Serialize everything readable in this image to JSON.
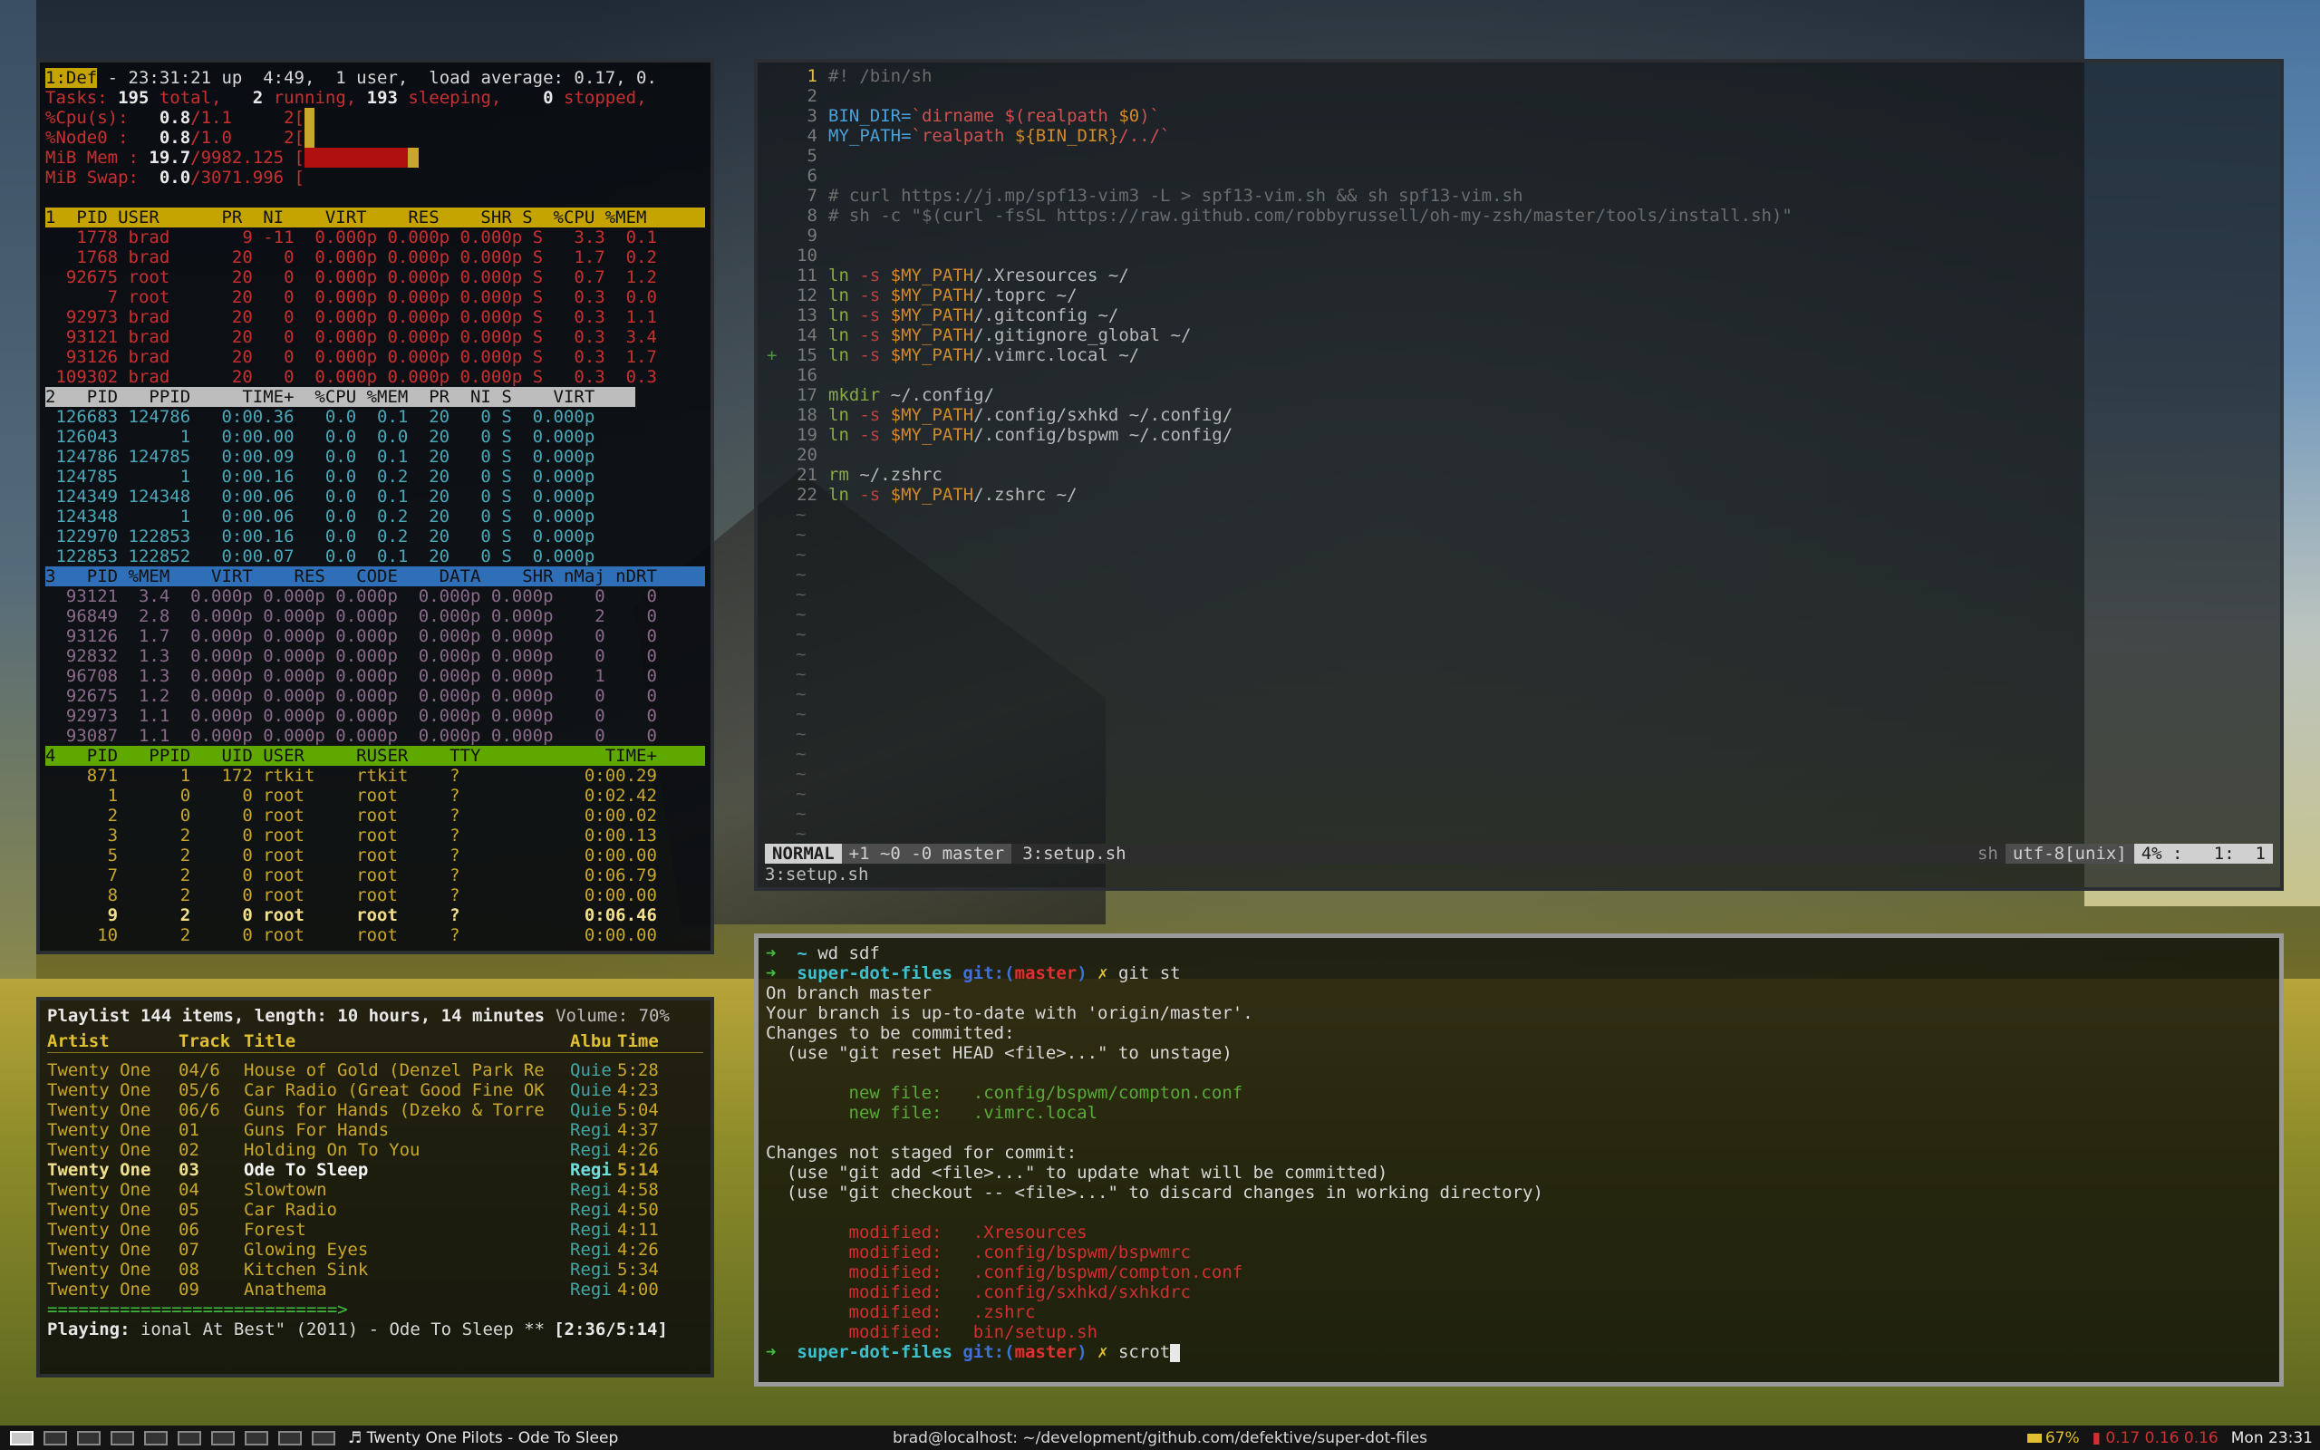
{
  "top": {
    "summary": [
      {
        "parts": [
          [
            "1:Def",
            "hdr1"
          ],
          [
            " - 23:31:21 up  4:49,  1 user,  load average: 0.17, 0.",
            "plain"
          ]
        ]
      },
      {
        "parts": [
          [
            "Tasks: ",
            "red"
          ],
          [
            "195",
            "w"
          ],
          [
            " total, ",
            "red"
          ],
          [
            "  2",
            "w"
          ],
          [
            " running, ",
            "red"
          ],
          [
            "193",
            "w"
          ],
          [
            " sleeping, ",
            "red"
          ],
          [
            "   0",
            "w"
          ],
          [
            " stopped,",
            "red"
          ]
        ]
      },
      {
        "parts": [
          [
            "%Cpu(s): ",
            "red"
          ],
          [
            "  0.8",
            "w"
          ],
          [
            "/1.1     2[",
            "red"
          ],
          [
            "|",
            "yel"
          ]
        ]
      },
      {
        "parts": [
          [
            "%Node0 : ",
            "red"
          ],
          [
            "  0.8",
            "w"
          ],
          [
            "/1.0     2[",
            "red"
          ],
          [
            "|",
            "yel"
          ]
        ]
      },
      {
        "parts": [
          [
            "MiB Mem : ",
            "red"
          ],
          [
            "19.7",
            "w"
          ],
          [
            "/9982.125 [",
            "red"
          ],
          [
            "||||||||||",
            "memred"
          ],
          [
            "|",
            "yel"
          ]
        ]
      },
      {
        "parts": [
          [
            "MiB Swap: ",
            "red"
          ],
          [
            " 0.0",
            "w"
          ],
          [
            "/3071.996 [",
            "red"
          ]
        ]
      }
    ],
    "h1": "1  PID USER      PR  NI    VIRT    RES    SHR S  %CPU %MEM ",
    "rows1": [
      "   1778 brad       9 -11  0.000p 0.000p 0.000p S   3.3  0.1",
      "   1768 brad      20   0  0.000p 0.000p 0.000p S   1.7  0.2",
      "  92675 root      20   0  0.000p 0.000p 0.000p S   0.7  1.2",
      "      7 root      20   0  0.000p 0.000p 0.000p S   0.3  0.0",
      "  92973 brad      20   0  0.000p 0.000p 0.000p S   0.3  1.1",
      "  93121 brad      20   0  0.000p 0.000p 0.000p S   0.3  3.4",
      "  93126 brad      20   0  0.000p 0.000p 0.000p S   0.3  1.7",
      " 109302 brad      20   0  0.000p 0.000p 0.000p S   0.3  0.3"
    ],
    "h2": "2   PID   PPID     TIME+  %CPU %MEM  PR  NI S    VIRT",
    "rows2": [
      " 126683 124786   0:00.36   0.0  0.1  20   0 S  0.000p",
      " 126043      1   0:00.00   0.0  0.0  20   0 S  0.000p",
      " 124786 124785   0:00.09   0.0  0.1  20   0 S  0.000p",
      " 124785      1   0:00.16   0.0  0.2  20   0 S  0.000p",
      " 124349 124348   0:00.06   0.0  0.1  20   0 S  0.000p",
      " 124348      1   0:00.06   0.0  0.2  20   0 S  0.000p",
      " 122970 122853   0:00.16   0.0  0.2  20   0 S  0.000p",
      " 122853 122852   0:00.07   0.0  0.1  20   0 S  0.000p"
    ],
    "h3": "3   PID %MEM    VIRT    RES   CODE    DATA    SHR nMaj nDRT",
    "rows3": [
      "  93121  3.4  0.000p 0.000p 0.000p  0.000p 0.000p    0    0",
      "  96849  2.8  0.000p 0.000p 0.000p  0.000p 0.000p    2    0",
      "  93126  1.7  0.000p 0.000p 0.000p  0.000p 0.000p    0    0",
      "  92832  1.3  0.000p 0.000p 0.000p  0.000p 0.000p    0    0",
      "  96708  1.3  0.000p 0.000p 0.000p  0.000p 0.000p    1    0",
      "  92675  1.2  0.000p 0.000p 0.000p  0.000p 0.000p    0    0",
      "  92973  1.1  0.000p 0.000p 0.000p  0.000p 0.000p    0    0",
      "  93087  1.1  0.000p 0.000p 0.000p  0.000p 0.000p    0    0"
    ],
    "h4": "4   PID   PPID   UID USER     RUSER    TTY            TIME+",
    "rows4": [
      {
        "text": "    871      1   172 rtkit    rtkit    ?            0:00.29",
        "bold": false
      },
      {
        "text": "      1      0     0 root     root     ?            0:02.42",
        "bold": false
      },
      {
        "text": "      2      0     0 root     root     ?            0:00.02",
        "bold": false
      },
      {
        "text": "      3      2     0 root     root     ?            0:00.13",
        "bold": false
      },
      {
        "text": "      5      2     0 root     root     ?            0:00.00",
        "bold": false
      },
      {
        "text": "      7      2     0 root     root     ?            0:06.79",
        "bold": false
      },
      {
        "text": "      8      2     0 root     root     ?            0:00.00",
        "bold": false
      },
      {
        "text": "      9      2     0 root     root     ?            0:06.46",
        "bold": true
      },
      {
        "text": "     10      2     0 root     root     ?            0:00.00",
        "bold": false
      }
    ]
  },
  "playlist": {
    "header": "Playlist 144 items, length: 10 hours, 14 minutes",
    "volume": "Volume: 70%",
    "columns": {
      "artist": "Artist",
      "track": "Track",
      "title": "Title",
      "album": "Albu",
      "time": "Time"
    },
    "rows": [
      {
        "artist": "Twenty One",
        "track": "04/6",
        "title": "House of Gold (Denzel Park Re",
        "album": "Quie",
        "time": "5:28",
        "selected": false
      },
      {
        "artist": "Twenty One",
        "track": "05/6",
        "title": "Car Radio (Great Good Fine OK",
        "album": "Quie",
        "time": "4:23",
        "selected": false
      },
      {
        "artist": "Twenty One",
        "track": "06/6",
        "title": "Guns for Hands (Dzeko & Torre",
        "album": "Quie",
        "time": "5:04",
        "selected": false
      },
      {
        "artist": "Twenty One",
        "track": "01",
        "title": "Guns For Hands",
        "album": "Regi",
        "time": "4:37",
        "selected": false
      },
      {
        "artist": "Twenty One",
        "track": "02",
        "title": "Holding On To You",
        "album": "Regi",
        "time": "4:26",
        "selected": false
      },
      {
        "artist": "Twenty One",
        "track": "03",
        "title": "Ode To Sleep",
        "album": "Regi",
        "time": "5:14",
        "selected": true
      },
      {
        "artist": "Twenty One",
        "track": "04",
        "title": "Slowtown",
        "album": "Regi",
        "time": "4:58",
        "selected": false
      },
      {
        "artist": "Twenty One",
        "track": "05",
        "title": "Car Radio",
        "album": "Regi",
        "time": "4:50",
        "selected": false
      },
      {
        "artist": "Twenty One",
        "track": "06",
        "title": "Forest",
        "album": "Regi",
        "time": "4:11",
        "selected": false
      },
      {
        "artist": "Twenty One",
        "track": "07",
        "title": "Glowing Eyes",
        "album": "Regi",
        "time": "4:26",
        "selected": false
      },
      {
        "artist": "Twenty One",
        "track": "08",
        "title": "Kitchen Sink",
        "album": "Regi",
        "time": "5:34",
        "selected": false
      },
      {
        "artist": "Twenty One",
        "track": "09",
        "title": "Anathema",
        "album": "Regi",
        "time": "4:00",
        "selected": false
      }
    ],
    "progress_bar": "============================>",
    "progress": 0.5,
    "playing_label": "Playing:",
    "playing_text": " ional At Best\" (2011) - Ode To Sleep **",
    "playing_time": "[2:36/5:14]"
  },
  "vim": {
    "lines": [
      {
        "n": "1",
        "sign": "",
        "parts": [
          [
            "#! /bin/sh",
            "cmt"
          ]
        ],
        "cur": true
      },
      {
        "n": "2",
        "sign": "",
        "parts": []
      },
      {
        "n": "3",
        "sign": "",
        "parts": [
          [
            "BIN_DIR=",
            "sh"
          ],
          [
            "`dirname ",
            "str"
          ],
          [
            "$(realpath ",
            "str"
          ],
          [
            "$0",
            "var"
          ],
          [
            ")`",
            "str"
          ]
        ]
      },
      {
        "n": "4",
        "sign": "",
        "parts": [
          [
            "MY_PATH=",
            "sh"
          ],
          [
            "`realpath ",
            "str"
          ],
          [
            "${BIN_DIR}",
            "var"
          ],
          [
            "/../`",
            "str"
          ]
        ]
      },
      {
        "n": "5",
        "sign": "",
        "parts": []
      },
      {
        "n": "6",
        "sign": "",
        "parts": []
      },
      {
        "n": "7",
        "sign": "",
        "parts": [
          [
            "# curl https://j.mp/spf13-vim3 -L > spf13-vim.sh && sh spf13-vim.sh",
            "cmt"
          ]
        ]
      },
      {
        "n": "8",
        "sign": "",
        "parts": [
          [
            "# sh -c \"$(curl -fsSL https://raw.github.com/robbyrussell/oh-my-zsh/master/tools/install.sh)\"",
            "cmt"
          ]
        ]
      },
      {
        "n": "9",
        "sign": "",
        "parts": []
      },
      {
        "n": "10",
        "sign": "",
        "parts": []
      },
      {
        "n": "11",
        "sign": "",
        "parts": [
          [
            "ln ",
            "cmd"
          ],
          [
            "-s ",
            "opt"
          ],
          [
            "$MY_PATH",
            "var"
          ],
          [
            "/.Xresources ~/",
            "plain"
          ]
        ]
      },
      {
        "n": "12",
        "sign": "",
        "parts": [
          [
            "ln ",
            "cmd"
          ],
          [
            "-s ",
            "opt"
          ],
          [
            "$MY_PATH",
            "var"
          ],
          [
            "/.toprc ~/",
            "plain"
          ]
        ]
      },
      {
        "n": "13",
        "sign": "",
        "parts": [
          [
            "ln ",
            "cmd"
          ],
          [
            "-s ",
            "opt"
          ],
          [
            "$MY_PATH",
            "var"
          ],
          [
            "/.gitconfig ~/",
            "plain"
          ]
        ]
      },
      {
        "n": "14",
        "sign": "",
        "parts": [
          [
            "ln ",
            "cmd"
          ],
          [
            "-s ",
            "opt"
          ],
          [
            "$MY_PATH",
            "var"
          ],
          [
            "/.gitignore_global ~/",
            "plain"
          ]
        ]
      },
      {
        "n": "15",
        "sign": "+",
        "parts": [
          [
            "ln ",
            "cmd"
          ],
          [
            "-s ",
            "opt"
          ],
          [
            "$MY_PATH",
            "var"
          ],
          [
            "/.vimrc.local ~/",
            "plain"
          ]
        ]
      },
      {
        "n": "16",
        "sign": "",
        "parts": []
      },
      {
        "n": "17",
        "sign": "",
        "parts": [
          [
            "mkdir ",
            "cmd"
          ],
          [
            "~/.config/",
            "plain"
          ]
        ]
      },
      {
        "n": "18",
        "sign": "",
        "parts": [
          [
            "ln ",
            "cmd"
          ],
          [
            "-s ",
            "opt"
          ],
          [
            "$MY_PATH",
            "var"
          ],
          [
            "/.config/sxhkd ~/.config/",
            "plain"
          ]
        ]
      },
      {
        "n": "19",
        "sign": "",
        "parts": [
          [
            "ln ",
            "cmd"
          ],
          [
            "-s ",
            "opt"
          ],
          [
            "$MY_PATH",
            "var"
          ],
          [
            "/.config/bspwm ~/.config/",
            "plain"
          ]
        ]
      },
      {
        "n": "20",
        "sign": "",
        "parts": []
      },
      {
        "n": "21",
        "sign": "",
        "parts": [
          [
            "rm ",
            "cmd"
          ],
          [
            "~/.zshrc",
            "plain"
          ]
        ]
      },
      {
        "n": "22",
        "sign": "",
        "parts": [
          [
            "ln ",
            "cmd"
          ],
          [
            "-s ",
            "opt"
          ],
          [
            "$MY_PATH",
            "var"
          ],
          [
            "/.zshrc ~/",
            "plain"
          ]
        ]
      }
    ],
    "tilde_count": 17,
    "status": {
      "mode": "NORMAL",
      "git": "+1 ~0 -0 master",
      "file": "3:setup.sh",
      "filetype": "sh",
      "encoding": "utf-8[unix]",
      "position": "4% :   1:  1"
    },
    "cmdline": "3:setup.sh"
  },
  "shell": {
    "lines": [
      [
        [
          "➜  ",
          "arrow"
        ],
        [
          "~ ",
          "dir"
        ],
        [
          "wd sdf",
          "plain"
        ]
      ],
      [
        [
          "➜  ",
          "arrow"
        ],
        [
          "super-dot-files ",
          "dir"
        ],
        [
          "git:(",
          "git"
        ],
        [
          "master",
          "branch"
        ],
        [
          ") ",
          "git"
        ],
        [
          "✗ ",
          "x"
        ],
        [
          "git st",
          "plain"
        ]
      ],
      [
        [
          "On branch master",
          "plain"
        ]
      ],
      [
        [
          "Your branch is up-to-date with 'origin/master'.",
          "plain"
        ]
      ],
      [
        [
          "Changes to be committed:",
          "plain"
        ]
      ],
      [
        [
          "  (use \"git reset HEAD <file>...\" to unstage)",
          "plain"
        ]
      ],
      [
        [
          "",
          "plain"
        ]
      ],
      [
        [
          "        new file:   .config/bspwm/compton.conf",
          "green"
        ]
      ],
      [
        [
          "        new file:   .vimrc.local",
          "green"
        ]
      ],
      [
        [
          "",
          "plain"
        ]
      ],
      [
        [
          "Changes not staged for commit:",
          "plain"
        ]
      ],
      [
        [
          "  (use \"git add <file>...\" to update what will be committed)",
          "plain"
        ]
      ],
      [
        [
          "  (use \"git checkout -- <file>...\" to discard changes in working directory)",
          "plain"
        ]
      ],
      [
        [
          "",
          "plain"
        ]
      ],
      [
        [
          "        modified:   .Xresources",
          "red"
        ]
      ],
      [
        [
          "        modified:   .config/bspwm/bspwmrc",
          "red"
        ]
      ],
      [
        [
          "        modified:   .config/bspwm/compton.conf",
          "red"
        ]
      ],
      [
        [
          "        modified:   .config/sxhkd/sxhkdrc",
          "red"
        ]
      ],
      [
        [
          "        modified:   .zshrc",
          "red"
        ]
      ],
      [
        [
          "        modified:   bin/setup.sh",
          "red"
        ]
      ],
      [
        [
          "➜  ",
          "arrow"
        ],
        [
          "super-dot-files ",
          "dir"
        ],
        [
          "git:(",
          "git"
        ],
        [
          "master",
          "branch"
        ],
        [
          ") ",
          "git"
        ],
        [
          "✗ ",
          "x"
        ],
        [
          "scrot",
          "plain"
        ]
      ]
    ]
  },
  "bar": {
    "workspaces": [
      true,
      false,
      false,
      false,
      false,
      false,
      false,
      false,
      false,
      false
    ],
    "now_playing": "♬ Twenty One Pilots - Ode To Sleep",
    "window_title": "brad@localhost: ~/development/github.com/defektive/super-dot-files",
    "battery": "67%",
    "load": "0.17 0.16 0.16",
    "clock": "Mon 23:31",
    "colors": {
      "battery": "#e0c030",
      "load": "#d03030",
      "accent": "#3fc03f"
    }
  }
}
